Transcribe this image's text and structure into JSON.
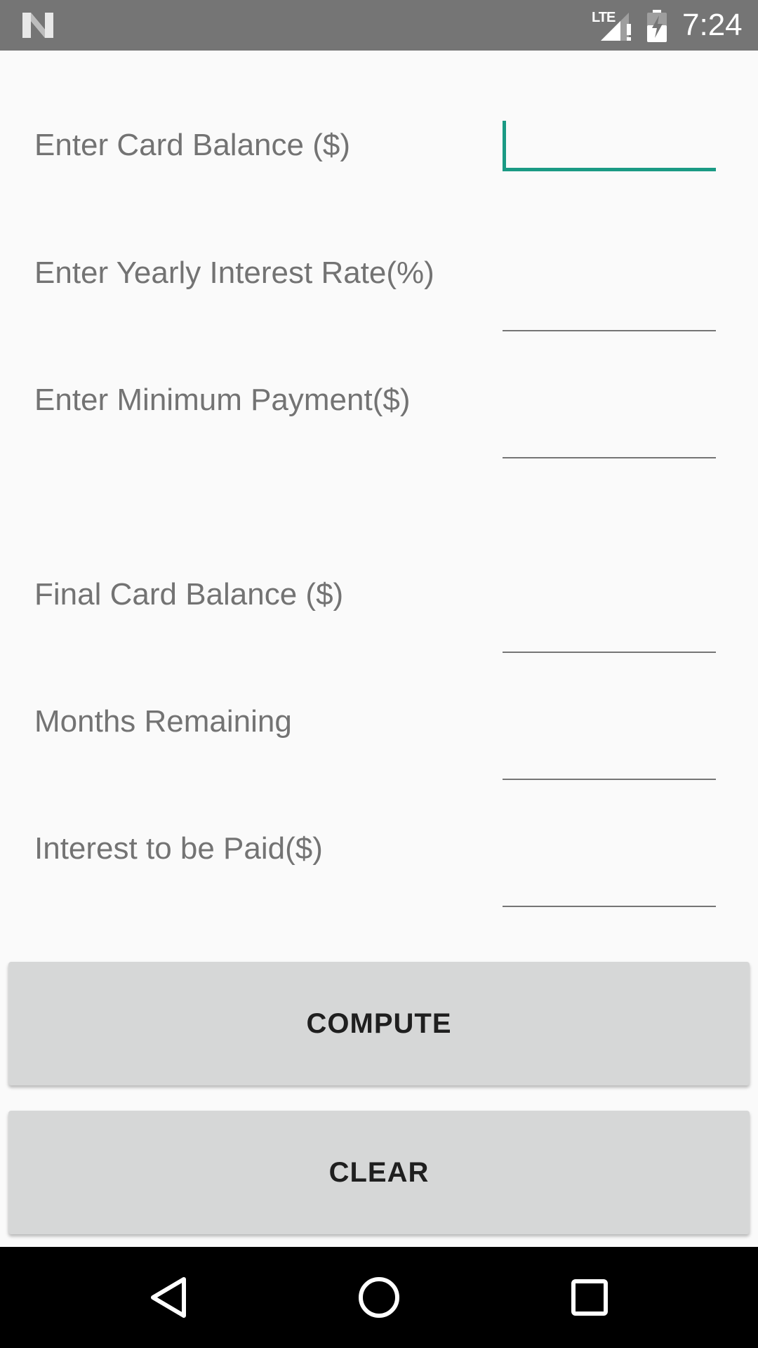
{
  "status_bar": {
    "network": "LTE",
    "time": "7:24",
    "icons": [
      "android-n-logo-icon",
      "lte-signal-icon",
      "battery-charging-icon"
    ]
  },
  "form": {
    "inputs": [
      {
        "label": "Enter Card Balance ($)",
        "value": "",
        "focused": true
      },
      {
        "label": "Enter Yearly Interest Rate(%)",
        "value": ""
      },
      {
        "label": "Enter Minimum Payment($)",
        "value": ""
      }
    ],
    "outputs": [
      {
        "label": "Final Card Balance ($)",
        "value": ""
      },
      {
        "label": "Months Remaining",
        "value": ""
      },
      {
        "label": "Interest to be Paid($)",
        "value": ""
      }
    ]
  },
  "buttons": {
    "compute": "COMPUTE",
    "clear": "CLEAR"
  },
  "nav_bar": {
    "icons": [
      "back-icon",
      "home-icon",
      "recents-icon"
    ]
  },
  "colors": {
    "accent": "#1a9a84",
    "status_bar": "#757575",
    "background": "#fafafa",
    "button": "#d6d7d7",
    "label_text": "#737373"
  }
}
